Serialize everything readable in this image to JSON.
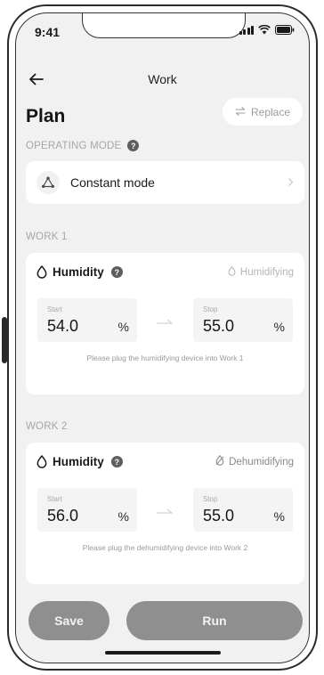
{
  "status_bar": {
    "time": "9:41",
    "icons": [
      "signal-icon",
      "wifi-icon",
      "battery-icon"
    ]
  },
  "nav": {
    "back_icon": "arrow-left-icon",
    "title": "Work"
  },
  "plan": {
    "title": "Plan",
    "replace_label": "Replace",
    "replace_icon": "swap-icon"
  },
  "operating_mode": {
    "section_label": "OPERATING MODE",
    "mode_label": "Constant mode",
    "mode_icon": "triangle-nodes-icon"
  },
  "works": [
    {
      "section_label": "WORK 1",
      "sensor_label": "Humidity",
      "status_label": "Humidifying",
      "start_caption": "Start",
      "start_value": "54.0",
      "start_unit": "%",
      "stop_caption": "Stop",
      "stop_value": "55.0",
      "stop_unit": "%",
      "hint": "Please plug the humidifying device into Work 1"
    },
    {
      "section_label": "WORK 2",
      "sensor_label": "Humidity",
      "status_label": "Dehumidifying",
      "start_caption": "Start",
      "start_value": "56.0",
      "start_unit": "%",
      "stop_caption": "Stop",
      "stop_value": "55.0",
      "stop_unit": "%",
      "hint": "Please plug the dehumidifying device into Work 2"
    }
  ],
  "actions": {
    "save_label": "Save",
    "run_label": "Run"
  },
  "colors": {
    "background": "#f1f1f1",
    "card": "#ffffff",
    "button_disabled": "#8f8f8f",
    "muted_text": "#a6a6a6"
  }
}
